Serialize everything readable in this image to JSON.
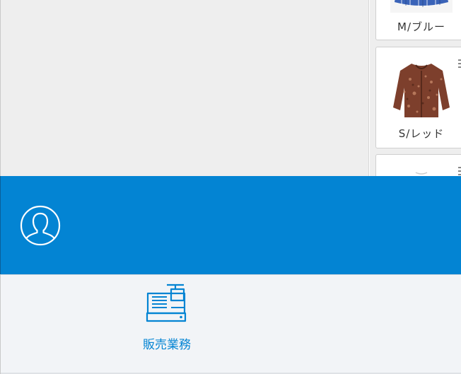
{
  "products": [
    {
      "variant": "M/ブルー",
      "thumb_color": "#3a63b8"
    },
    {
      "variant": "S/レッド",
      "thumb_color": "#8a4a34"
    },
    {
      "variant": "",
      "thumb_color": "#dddddd"
    }
  ],
  "user": {
    "avatar_icon": "user-avatar-icon"
  },
  "menu": {
    "items": [
      {
        "label": "販売業務",
        "icon": "cash-register-icon"
      }
    ]
  },
  "colors": {
    "accent": "#0384d3",
    "panel_gray": "#eeeeee",
    "bottom_bg": "#f2f4f7"
  }
}
